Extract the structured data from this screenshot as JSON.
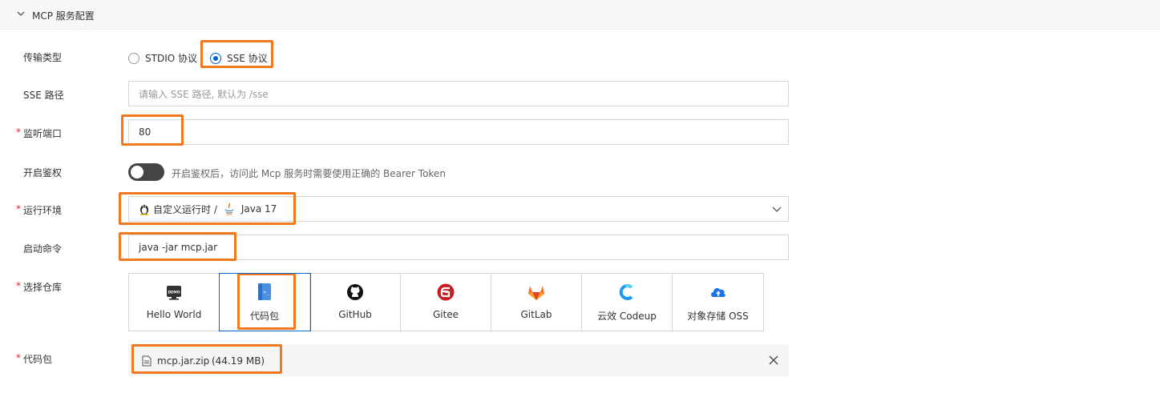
{
  "panel": {
    "title": "MCP 服务配置"
  },
  "transport": {
    "label": "传输类型",
    "options": [
      "STDIO 协议",
      "SSE 协议"
    ],
    "selected": "SSE 协议"
  },
  "sse_path": {
    "label": "SSE 路径",
    "placeholder": "请输入 SSE 路径, 默认为 /sse"
  },
  "port": {
    "label": "监听端口",
    "required_mark": "*",
    "value": "80"
  },
  "auth": {
    "label": "开启鉴权",
    "enabled": false,
    "hint": "开启鉴权后，访问此 Mcp 服务时需要使用正确的 Bearer Token"
  },
  "runtime": {
    "label": "运行环境",
    "required_mark": "*",
    "runtime_name": "自定义运行时 /",
    "version": "Java 17",
    "runtime_icon": "linux-penguin-icon",
    "version_icon": "java-icon"
  },
  "start_cmd": {
    "label": "启动命令",
    "value": "java -jar mcp.jar"
  },
  "repo": {
    "label": "选择仓库",
    "required_mark": "*",
    "selected": "代码包",
    "items": [
      {
        "name": "Hello World",
        "icon": "demo-icon"
      },
      {
        "name": "代码包",
        "icon": "code-package-icon"
      },
      {
        "name": "GitHub",
        "icon": "github-icon"
      },
      {
        "name": "Gitee",
        "icon": "gitee-icon"
      },
      {
        "name": "GitLab",
        "icon": "gitlab-icon"
      },
      {
        "name": "云效 Codeup",
        "icon": "codeup-icon"
      },
      {
        "name": "对象存储 OSS",
        "icon": "oss-icon"
      }
    ]
  },
  "package": {
    "label": "代码包",
    "required_mark": "*",
    "file_name": "mcp.jar.zip",
    "file_size": "(44.19 MB)"
  },
  "colors": {
    "accent": "#0064c8",
    "highlight": "#f07820",
    "required": "#e02020"
  }
}
